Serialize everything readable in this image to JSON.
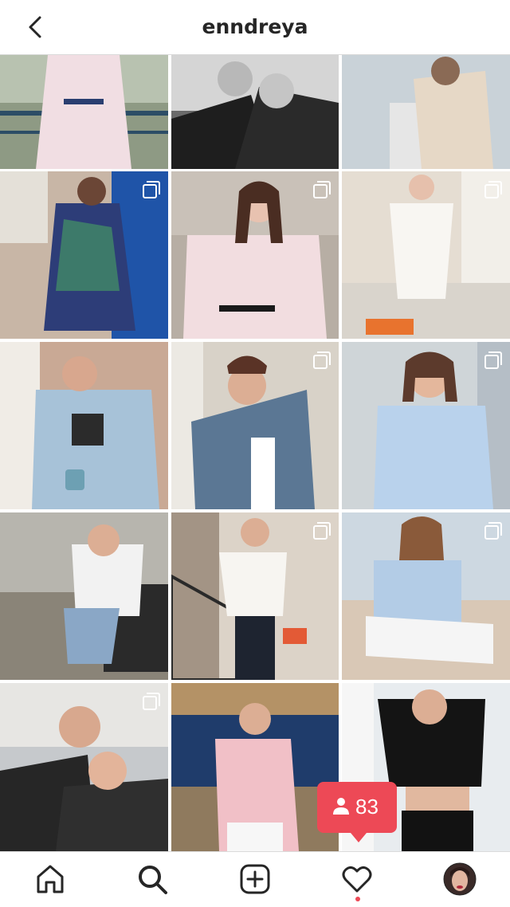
{
  "header": {
    "username": "enndreya"
  },
  "posts": [
    {
      "id": "p1",
      "multi": false,
      "desc": "floral-dress-bridge"
    },
    {
      "id": "p2",
      "multi": false,
      "desc": "bw-couple"
    },
    {
      "id": "p3",
      "multi": false,
      "desc": "blazer-pier"
    },
    {
      "id": "p4",
      "multi": true,
      "desc": "blue-patterned-dress"
    },
    {
      "id": "p5",
      "multi": true,
      "desc": "floral-blouse"
    },
    {
      "id": "p6",
      "multi": true,
      "desc": "white-outfit-bed"
    },
    {
      "id": "p7",
      "multi": false,
      "desc": "denim-shirt-mug"
    },
    {
      "id": "p8",
      "multi": true,
      "desc": "denim-jacket-wall"
    },
    {
      "id": "p9",
      "multi": true,
      "desc": "light-blue-shirt"
    },
    {
      "id": "p10",
      "multi": false,
      "desc": "white-sweater-bench"
    },
    {
      "id": "p11",
      "multi": true,
      "desc": "white-top-stairs"
    },
    {
      "id": "p12",
      "multi": true,
      "desc": "blue-shirt-sitting"
    },
    {
      "id": "p13",
      "multi": true,
      "desc": "couple-leather"
    },
    {
      "id": "p14",
      "multi": false,
      "desc": "pink-sweater-balcony"
    },
    {
      "id": "p15",
      "multi": false,
      "desc": "black-crop-top"
    }
  ],
  "notification": {
    "count": "83",
    "icon": "person-icon",
    "color": "#ed4956"
  },
  "nav": {
    "items": [
      "home-icon",
      "search-icon",
      "add-icon",
      "heart-icon",
      "profile-avatar"
    ],
    "active": "search-icon"
  }
}
